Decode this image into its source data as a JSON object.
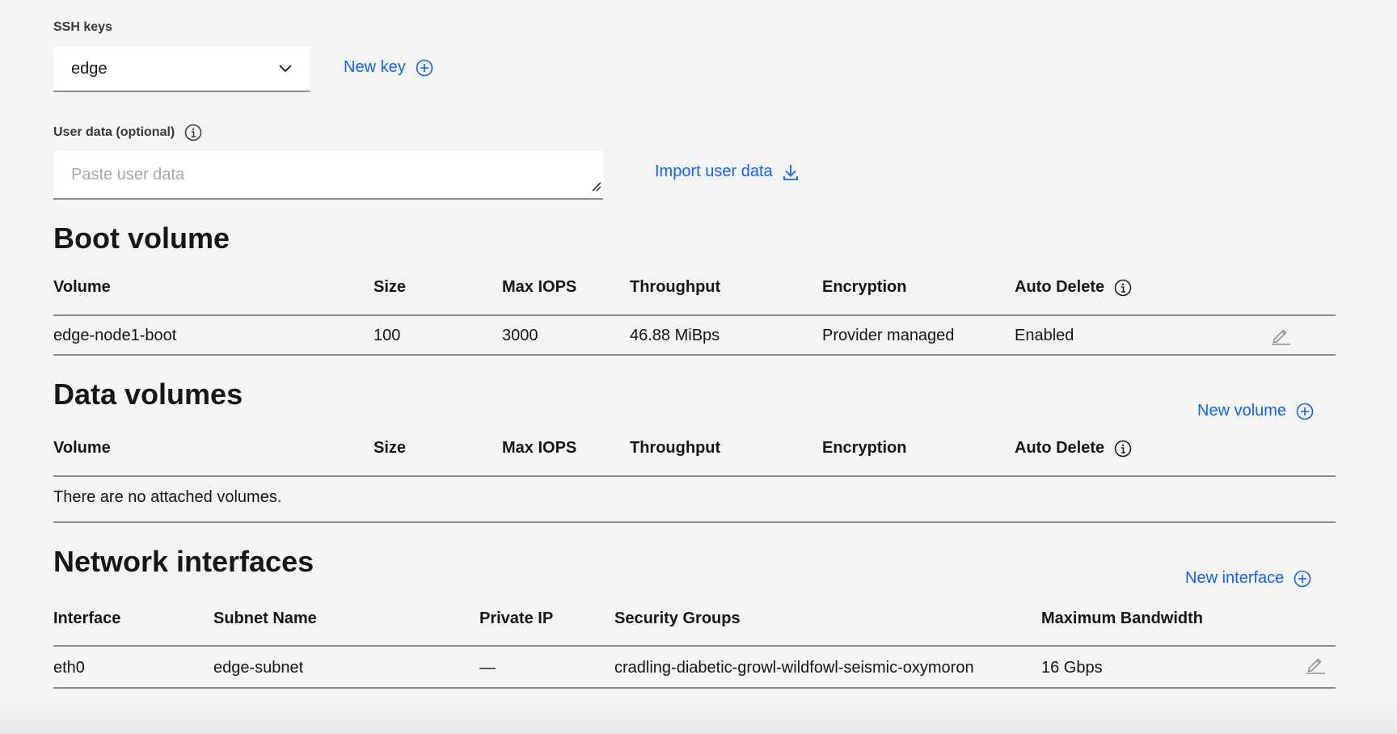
{
  "ssh": {
    "label": "SSH keys",
    "selected": "edge",
    "new_key": "New key"
  },
  "user_data": {
    "label": "User data (optional)",
    "placeholder": "Paste user data",
    "import": "Import user data"
  },
  "boot_volume": {
    "title": "Boot volume",
    "columns": [
      "Volume",
      "Size",
      "Max IOPS",
      "Throughput",
      "Encryption",
      "Auto Delete"
    ],
    "rows": [
      [
        "edge-node1-boot",
        "100",
        "3000",
        "46.88 MiBps",
        "Provider managed",
        "Enabled"
      ]
    ]
  },
  "data_volumes": {
    "title": "Data volumes",
    "new_volume": "New volume",
    "columns": [
      "Volume",
      "Size",
      "Max IOPS",
      "Throughput",
      "Encryption",
      "Auto Delete"
    ],
    "empty": "There are no attached volumes."
  },
  "network": {
    "title": "Network interfaces",
    "new_interface": "New interface",
    "columns": [
      "Interface",
      "Subnet Name",
      "Private IP",
      "Security Groups",
      "Maximum Bandwidth"
    ],
    "rows": [
      [
        "eth0",
        "edge-subnet",
        "—",
        "cradling-diabetic-growl-wildfowl-seismic-oxymoron",
        "16 Gbps"
      ]
    ]
  },
  "colors": {
    "background": "#f4f4f4",
    "link": "#0f62fe",
    "field": "#ffffff",
    "rule": "#8d8d8d"
  }
}
